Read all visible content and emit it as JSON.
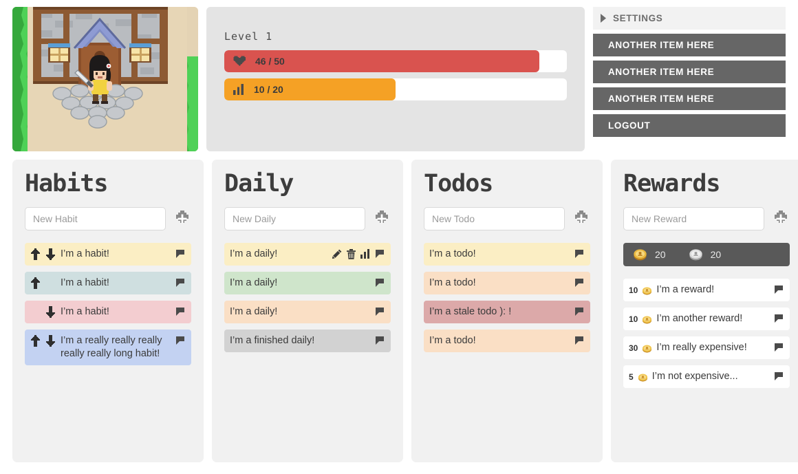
{
  "avatar": {
    "scene": "pixel-art-village-house-with-character",
    "alt": "Character avatar standing in front of a stone and timber house"
  },
  "stats": {
    "level_label": "Level 1",
    "health": {
      "icon": "heart-icon",
      "text": "46 / 50",
      "current": 46,
      "max": 50,
      "percent": 92,
      "color": "#d9534f"
    },
    "experience": {
      "icon": "bar-chart-icon",
      "text": "10 / 20",
      "current": 10,
      "max": 20,
      "percent": 50,
      "color": "#f5a125"
    }
  },
  "menu": {
    "header": {
      "label": "SETTINGS",
      "icon": "triangle-right-icon"
    },
    "items": [
      {
        "label": "ANOTHER ITEM HERE"
      },
      {
        "label": "ANOTHER ITEM HERE"
      },
      {
        "label": "ANOTHER ITEM HERE"
      },
      {
        "label": "LOGOUT"
      }
    ]
  },
  "columns": [
    {
      "key": "habits",
      "title": "Habits",
      "input_placeholder": "New Habit",
      "add_icon": "plus-icon",
      "tasks": [
        {
          "label": "I’m a habit!",
          "color": "#fbeec4",
          "up": true,
          "down": true,
          "note_icon": "flag-icon"
        },
        {
          "label": "I’m a habit!",
          "color": "#cfdfe0",
          "up": true,
          "down": false,
          "note_icon": "flag-icon"
        },
        {
          "label": "I’m a habit!",
          "color": "#f3cdd0",
          "up": false,
          "down": true,
          "note_icon": "flag-icon"
        },
        {
          "label": "I’m a really really really really really long habit!",
          "color": "#c3d2f2",
          "up": true,
          "down": true,
          "note_icon": "flag-icon"
        }
      ]
    },
    {
      "key": "daily",
      "title": "Daily",
      "input_placeholder": "New Daily",
      "add_icon": "plus-icon",
      "tasks": [
        {
          "label": "I’m a daily!",
          "color": "#fbeec4",
          "icons": [
            "pencil-icon",
            "trash-icon",
            "bar-chart-icon",
            "flag-icon"
          ]
        },
        {
          "label": "I’m a daily!",
          "color": "#cfe5cb",
          "icons": [
            "flag-icon"
          ]
        },
        {
          "label": "I’m a daily!",
          "color": "#fadfc5",
          "icons": [
            "flag-icon"
          ]
        },
        {
          "label": "I’m a finished daily!",
          "color": "#d2d2d2",
          "icons": [
            "flag-icon"
          ]
        }
      ]
    },
    {
      "key": "todos",
      "title": "Todos",
      "input_placeholder": "New Todo",
      "add_icon": "plus-icon",
      "tasks": [
        {
          "label": "I’m a todo!",
          "color": "#fbeec4",
          "icons": [
            "flag-icon"
          ]
        },
        {
          "label": "I’m a todo!",
          "color": "#fadfc5",
          "icons": [
            "flag-icon"
          ]
        },
        {
          "label": "I’m a stale todo ): !",
          "color": "#dca9a9",
          "icons": [
            "flag-icon"
          ]
        },
        {
          "label": "I’m a todo!",
          "color": "#fadfc5",
          "icons": [
            "flag-icon"
          ]
        }
      ]
    },
    {
      "key": "rewards",
      "title": "Rewards",
      "input_placeholder": "New Reward",
      "add_icon": "plus-icon",
      "bank": {
        "gold_icon": "gold-coin-icon",
        "gold_value": "20",
        "silver_icon": "silver-coin-icon",
        "silver_value": "20"
      },
      "tasks": [
        {
          "label": "I’m a reward!",
          "cost": "10",
          "coin_icon": "gold-coin-icon",
          "note_icon": "flag-icon"
        },
        {
          "label": "I’m another reward!",
          "cost": "10",
          "coin_icon": "gold-coin-icon",
          "note_icon": "flag-icon"
        },
        {
          "label": "I’m really expensive!",
          "cost": "30",
          "coin_icon": "gold-coin-icon",
          "note_icon": "flag-icon"
        },
        {
          "label": "I’m not expensive...",
          "cost": "5",
          "coin_icon": "gold-coin-icon",
          "note_icon": "flag-icon"
        }
      ]
    }
  ]
}
